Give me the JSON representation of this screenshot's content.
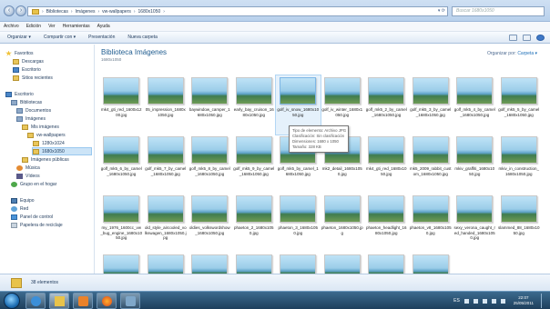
{
  "address": {
    "breadcrumbs": [
      "Bibliotecas",
      "Imágenes",
      "vw-wallpapers",
      "1680x1050"
    ],
    "search_placeholder": "Buscar 1680x1050"
  },
  "menu": [
    "Archivo",
    "Edición",
    "Ver",
    "Herramientas",
    "Ayuda"
  ],
  "toolbar": {
    "organize": "Organizar ▾",
    "share": "Compartir con ▾",
    "slideshow": "Presentación",
    "new_folder": "Nueva carpeta"
  },
  "sidebar": {
    "items": [
      {
        "label": "Favoritos",
        "icon": "star-icon"
      },
      {
        "label": "Descargas",
        "icon": "folder-icon"
      },
      {
        "label": "Escritorio",
        "icon": "desktop-icon"
      },
      {
        "label": "Sitios recientes",
        "icon": "recent-icon"
      },
      {
        "label": "Escritorio",
        "icon": "desktop-icon"
      },
      {
        "label": "Bibliotecas",
        "icon": "library-icon"
      },
      {
        "label": "Documentos",
        "icon": "documents-icon"
      },
      {
        "label": "Imágenes",
        "icon": "pictures-icon"
      },
      {
        "label": "Mis imágenes",
        "icon": "folder-icon"
      },
      {
        "label": "vw-wallpapers",
        "icon": "folder-icon"
      },
      {
        "label": "1280x1024",
        "icon": "folder-icon"
      },
      {
        "label": "1680x1050",
        "icon": "folder-icon"
      },
      {
        "label": "Imágenes públicas",
        "icon": "folder-icon"
      },
      {
        "label": "Música",
        "icon": "music-icon"
      },
      {
        "label": "Vídeos",
        "icon": "video-icon"
      },
      {
        "label": "Grupo en el hogar",
        "icon": "homegroup-icon"
      },
      {
        "label": "Equipo",
        "icon": "computer-icon"
      },
      {
        "label": "Red",
        "icon": "network-icon"
      },
      {
        "label": "Panel de control",
        "icon": "control-panel-icon"
      },
      {
        "label": "Papelera de reciclaje",
        "icon": "recycle-bin-icon"
      }
    ]
  },
  "content": {
    "title": "Biblioteca Imágenes",
    "subtitle": "1680x1050",
    "arrange_label": "Organizar por:",
    "arrange_value": "Carpeta ▾",
    "files": [
      "mk4_gti_red_1600x1200.jpg",
      "05_impression_1680x1050.jpg",
      "baywindow_camper_1680x1050.jpg",
      "early_bay_cruison_1680x1050.jpg",
      "golf_iv_snow_1680x1050.jpg",
      "golf_iv_winter_1680x1050.jpg",
      "golf_mk5_2_by_camel_1680x1050.jpg",
      "golf_mk5_3_by_camel_1680x1050.jpg",
      "golf_mk5_4_by_camel_1680x1050.jpg",
      "golf_mk5_5_by_camel_1680x1050.jpg",
      "golf_mk5_6_by_camel_1680x1050.jpg",
      "golf_mk5_7_by_camel_1680x1050.jpg",
      "golf_mk5_8_by_camel_1680x1050.jpg",
      "golf_mk5_9_by_camel_1680x1050.jpg",
      "golf_mk5_by_camel_1680x1050.jpg",
      "mk2_detail_1680x1050.jpg",
      "mk4_gti_red_1680x1050.jpg",
      "mk5_2009_rabbit_custom_1680x1050.jpg",
      "mkiv_graffiti_1680x1050.jpg",
      "mkiv_in_construction_1680x1050.jpg",
      "my_1976_1600cc_vw_bug_engine_1680x1050.jpg",
      "old_style_aircooled_volkswagen_1680x1050.jpg",
      "oldies_volkswordshow_1680x1050.jpg",
      "phaeton_2_1680x1050.jpg",
      "phaeton_3_1680x1050.jpg",
      "phaeton_1680x1050.jpg",
      "phaeton_headlight_1680x1050.jpg",
      "phaeton_v8_1680x1050.jpg",
      "sexy_verona_caught_red_handed_1680x1050.jpg",
      "slammed_88_1680x1050.jpg",
      "",
      "",
      "",
      "",
      "",
      "",
      "",
      ""
    ],
    "tooltip": [
      "Tipo de elemento: Archivo JPG",
      "Clasificación: Sin clasificación",
      "Dimensiones: 1680 x 1050",
      "Tamaño: 328 KB"
    ]
  },
  "details": {
    "count": "38 elementos"
  },
  "taskbar": {
    "language": "ES",
    "time": "22:07",
    "date": "25/05/2011"
  }
}
